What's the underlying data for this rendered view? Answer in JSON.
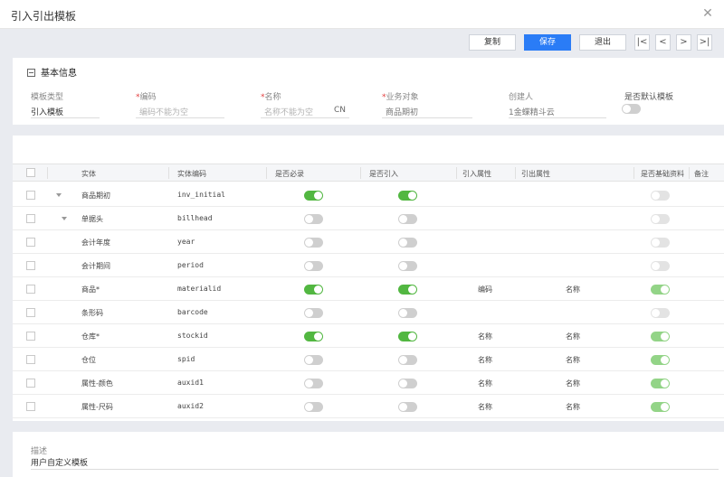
{
  "window": {
    "title": "引入引出模板"
  },
  "toolbar": {
    "copy": "复制",
    "save": "保存",
    "exit": "退出"
  },
  "pager": {
    "first": "|<",
    "prev": "<",
    "next": ">",
    "last": ">|"
  },
  "basic": {
    "title": "基本信息",
    "template_type": {
      "label": "模板类型",
      "value": "引入模板"
    },
    "code": {
      "label": "编码",
      "placeholder": "编码不能为空"
    },
    "name": {
      "label": "名称",
      "placeholder": "名称不能为空",
      "lang": "CN"
    },
    "biz_object": {
      "label": "业务对象",
      "value": "商品期初"
    },
    "creator": {
      "label": "创建人",
      "value": "1金蝶精斗云"
    },
    "default_template": {
      "label": "是否默认模板",
      "on": false
    }
  },
  "grid": {
    "headers": [
      "实体",
      "实体编码",
      "是否必录",
      "是否引入",
      "引入属性",
      "引出属性",
      "是否基础资料",
      "备注"
    ],
    "rows": [
      {
        "entity": "商品期初",
        "code": "inv_initial",
        "required": true,
        "imported": true,
        "imp_attr": "",
        "exp_attr": "",
        "basic": "doff",
        "arrow": 1
      },
      {
        "entity": "单据头",
        "code": "billhead",
        "required": false,
        "imported": false,
        "imp_attr": "",
        "exp_attr": "",
        "basic": "doff",
        "arrow": 2
      },
      {
        "entity": "会计年度",
        "code": "year",
        "required": false,
        "imported": false,
        "imp_attr": "",
        "exp_attr": "",
        "basic": "doff",
        "arrow": 0
      },
      {
        "entity": "会计期间",
        "code": "period",
        "required": false,
        "imported": false,
        "imp_attr": "",
        "exp_attr": "",
        "basic": "doff",
        "arrow": 0
      },
      {
        "entity": "商品*",
        "code": "materialid",
        "required": true,
        "imported": true,
        "imp_attr": "编码",
        "exp_attr": "名称",
        "basic": "don",
        "arrow": 0
      },
      {
        "entity": "条形码",
        "code": "barcode",
        "required": false,
        "imported": false,
        "imp_attr": "",
        "exp_attr": "",
        "basic": "doff",
        "arrow": 0
      },
      {
        "entity": "仓库*",
        "code": "stockid",
        "required": true,
        "imported": true,
        "imp_attr": "名称",
        "exp_attr": "名称",
        "basic": "don",
        "arrow": 0
      },
      {
        "entity": "仓位",
        "code": "spid",
        "required": false,
        "imported": false,
        "imp_attr": "名称",
        "exp_attr": "名称",
        "basic": "don",
        "arrow": 0
      },
      {
        "entity": "属性-颜色",
        "code": "auxid1",
        "required": false,
        "imported": false,
        "imp_attr": "名称",
        "exp_attr": "名称",
        "basic": "don",
        "arrow": 0
      },
      {
        "entity": "属性-尺码",
        "code": "auxid2",
        "required": false,
        "imported": false,
        "imp_attr": "名称",
        "exp_attr": "名称",
        "basic": "don",
        "arrow": 0
      }
    ]
  },
  "description": {
    "label": "描述",
    "value": "用户自定义模板"
  },
  "colors": {
    "primary": "#2a7cf6",
    "toggle_on": "#52b741",
    "toggle_on_disabled": "#93d487",
    "required_mark": "#e23e3e"
  }
}
